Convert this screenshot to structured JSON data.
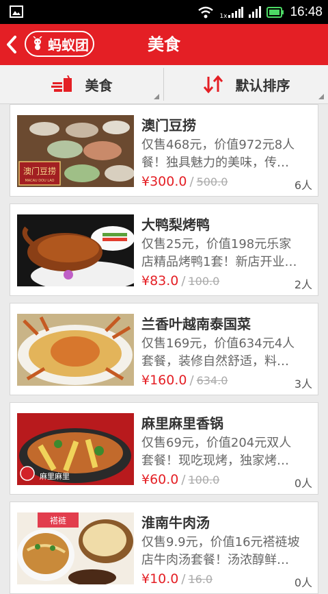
{
  "status_bar": {
    "time": "16:48",
    "network_label": "1x",
    "icons": [
      "image-icon",
      "wifi-icon",
      "signal-icon",
      "battery-icon"
    ]
  },
  "header": {
    "logo_text": "蚂蚁团",
    "title": "美食",
    "accent_color": "#e41f25"
  },
  "filters": [
    {
      "label": "美食",
      "icon": "food-icon"
    },
    {
      "label": "默认排序",
      "icon": "sort-icon"
    }
  ],
  "deals": [
    {
      "title": "澳门豆捞",
      "desc_line1": "仅售468元，价值972元8人",
      "desc_line2": "餐！独具魅力的美味，传…",
      "price": "¥300.0",
      "original_price": "500.0",
      "sold": "6人",
      "thumb_text": "澳门豆捞",
      "thumb_subtext": "MACAU DOU LAO"
    },
    {
      "title": "大鸭梨烤鸭",
      "desc_line1": "仅售25元，价值198元乐家",
      "desc_line2": "店精品烤鸭1套！新店开业…",
      "price": "¥83.0",
      "original_price": "100.0",
      "sold": "2人"
    },
    {
      "title": "兰香叶越南泰国菜",
      "desc_line1": "仅售169元，价值634元4人",
      "desc_line2": "套餐，装修自然舒适，料…",
      "price": "¥160.0",
      "original_price": "634.0",
      "sold": "3人"
    },
    {
      "title": "麻里麻里香锅",
      "desc_line1": "仅售69元，价值204元双人",
      "desc_line2": "套餐！现吃现烤，独家烤…",
      "price": "¥60.0",
      "original_price": "100.0",
      "sold": "0人",
      "thumb_text": "麻里麻里"
    },
    {
      "title": "淮南牛肉汤",
      "desc_line1": "仅售9.9元，价值16元褡裢坡",
      "desc_line2": "店牛肉汤套餐！汤浓醇鲜…",
      "price": "¥10.0",
      "original_price": "16.0",
      "sold": "0人",
      "thumb_text": "褡裢"
    }
  ]
}
